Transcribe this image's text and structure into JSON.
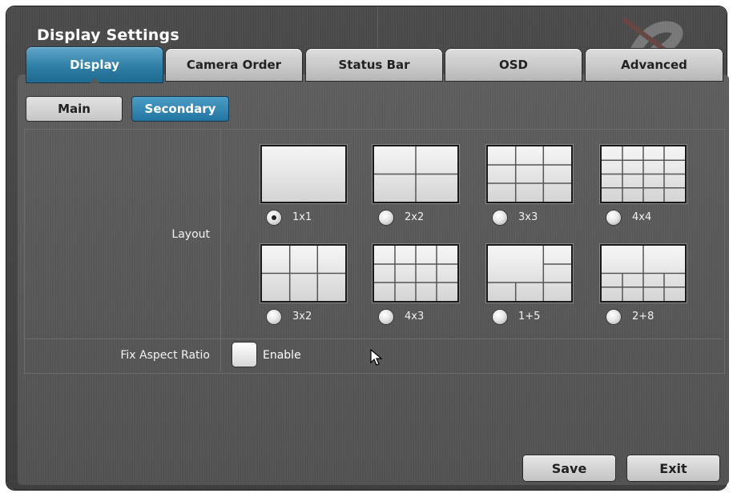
{
  "window": {
    "title": "Display Settings"
  },
  "tabs": [
    {
      "label": "Display",
      "active": true
    },
    {
      "label": "Camera Order",
      "active": false
    },
    {
      "label": "Status Bar",
      "active": false
    },
    {
      "label": "OSD",
      "active": false
    },
    {
      "label": "Advanced",
      "active": false
    }
  ],
  "subtabs": {
    "main": "Main",
    "secondary": "Secondary",
    "selected": "Secondary"
  },
  "layout": {
    "label": "Layout",
    "selected": "1x1",
    "options": [
      {
        "label": "1x1",
        "selected": true
      },
      {
        "label": "2x2",
        "selected": false
      },
      {
        "label": "3x3",
        "selected": false
      },
      {
        "label": "4x4",
        "selected": false
      },
      {
        "label": "3x2",
        "selected": false
      },
      {
        "label": "4x3",
        "selected": false
      },
      {
        "label": "1+5",
        "selected": false
      },
      {
        "label": "2+8",
        "selected": false
      }
    ]
  },
  "aspect_ratio": {
    "label": "Fix Aspect Ratio",
    "checkbox_label": "Enable",
    "checked": false
  },
  "buttons": {
    "save": "Save",
    "exit": "Exit"
  },
  "colors": {
    "accent": "#2e7ea6",
    "panel": "#575757",
    "tab_inactive": "#c9c9c9"
  }
}
